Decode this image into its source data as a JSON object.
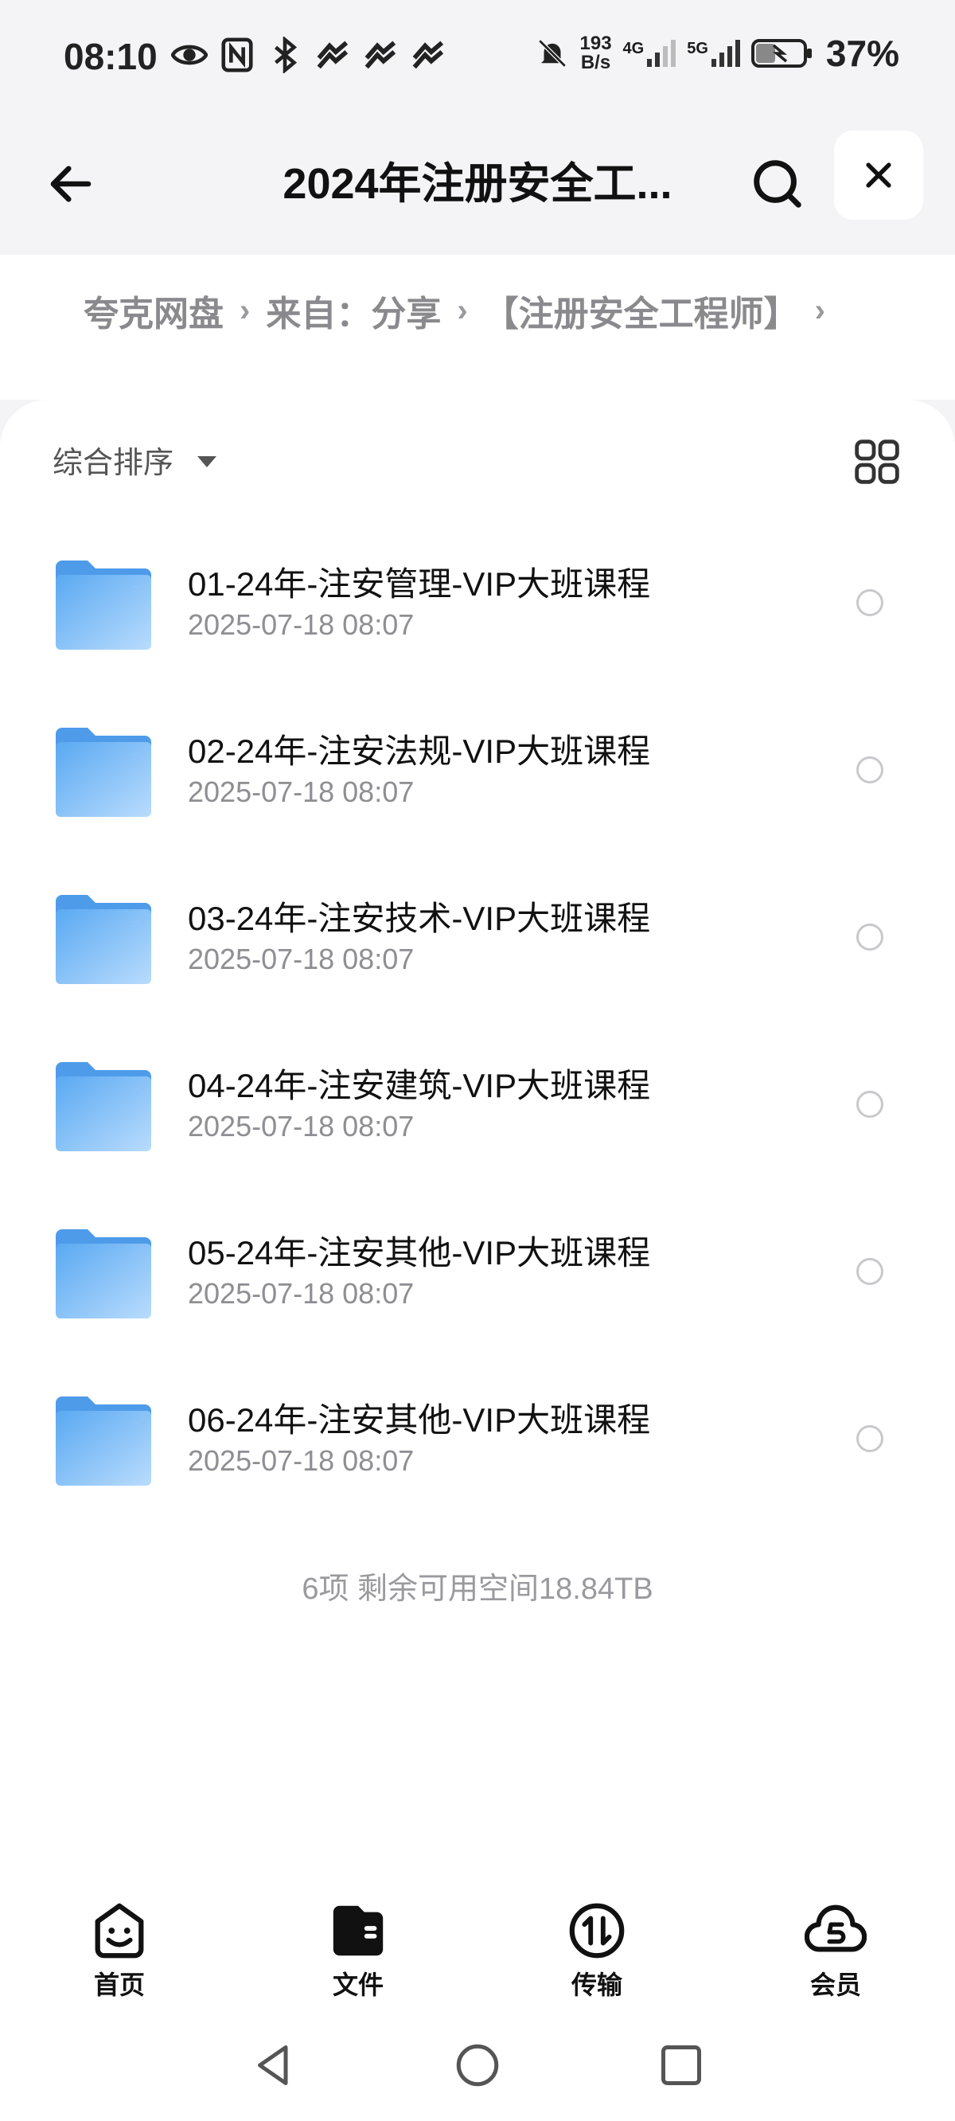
{
  "status_bar": {
    "time": "08:10",
    "net_speed_top": "193",
    "net_speed_bottom": "B/s",
    "sim1_label": "4G",
    "sim2_label": "5G",
    "battery": "37%",
    "icons": [
      "eye-icon",
      "nfc-icon",
      "bluetooth-icon",
      "heartrate-icon",
      "heartrate-icon",
      "heartrate-icon",
      "mute-bell-icon",
      "signal-icon",
      "battery-icon"
    ]
  },
  "header": {
    "title": "2024年注册安全工..."
  },
  "breadcrumb": {
    "items": [
      "夸克网盘",
      "来自：分享",
      "【注册安全工程师】"
    ]
  },
  "toolbar": {
    "sort_label": "综合排序"
  },
  "files": [
    {
      "name": "01-24年-注安管理-VIP大班课程",
      "date": "2025-07-18 08:07"
    },
    {
      "name": "02-24年-注安法规-VIP大班课程",
      "date": "2025-07-18 08:07"
    },
    {
      "name": "03-24年-注安技术-VIP大班课程",
      "date": "2025-07-18 08:07"
    },
    {
      "name": "04-24年-注安建筑-VIP大班课程",
      "date": "2025-07-18 08:07"
    },
    {
      "name": "05-24年-注安其他-VIP大班课程",
      "date": "2025-07-18 08:07"
    },
    {
      "name": "06-24年-注安其他-VIP大班课程",
      "date": "2025-07-18 08:07"
    }
  ],
  "summary": "6项 剩余可用空间18.84TB",
  "bottom_nav": {
    "home": "首页",
    "files": "文件",
    "transfer": "传输",
    "member": "会员"
  },
  "colors": {
    "folder_blue": "#6cb4f6",
    "background": "#f4f4f6",
    "panel": "#ffffff"
  }
}
